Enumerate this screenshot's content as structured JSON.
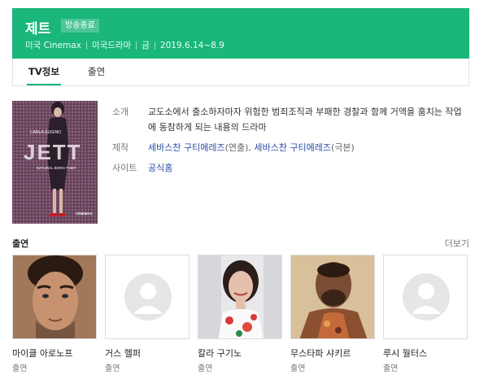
{
  "header": {
    "title": "제트",
    "badge": "방송종료",
    "meta": [
      "미국 Cinemax",
      "미국드라마",
      "금",
      "2019.6.14~8.9"
    ]
  },
  "tabs": [
    {
      "label": "TV정보",
      "active": true
    },
    {
      "label": "출연",
      "active": false
    }
  ],
  "poster": {
    "actor_text": "CARLA GUGINO",
    "title_text": "JETT",
    "tagline_text": "NATURAL BORN THIEF",
    "brand_text": "CINEMAX"
  },
  "info": {
    "synopsis_label": "소개",
    "synopsis": "교도소에서 출소하자마자 위험한 범죄조직과 부패한 경찰과 함께 거액을 훔치는 작업에 동참하게 되는 내용의 드라마",
    "production_label": "제작",
    "production": [
      {
        "name": "세바스찬 구티에레즈",
        "role": "(연출)"
      },
      {
        "name": "세바스찬 구티에레즈",
        "role": "(극본)"
      }
    ],
    "production_separator": ",",
    "site_label": "사이트",
    "site_link": "공식홈"
  },
  "cast_section": {
    "title": "출연",
    "more": "더보기",
    "members": [
      {
        "name": "마이클 아로노프",
        "role": "출연",
        "photo": "man-short-hair-photo"
      },
      {
        "name": "거스 헬퍼",
        "role": "출연",
        "photo": "placeholder-avatar-icon"
      },
      {
        "name": "칼라 구기노",
        "role": "출연",
        "photo": "woman-floral-dress-photo"
      },
      {
        "name": "무스타파 샤키르",
        "role": "출연",
        "photo": "man-beard-photo"
      },
      {
        "name": "루시 월터스",
        "role": "출연",
        "photo": "placeholder-avatar-icon"
      }
    ]
  },
  "colors": {
    "accent": "#1ab67a",
    "link": "#2b4ba6"
  }
}
